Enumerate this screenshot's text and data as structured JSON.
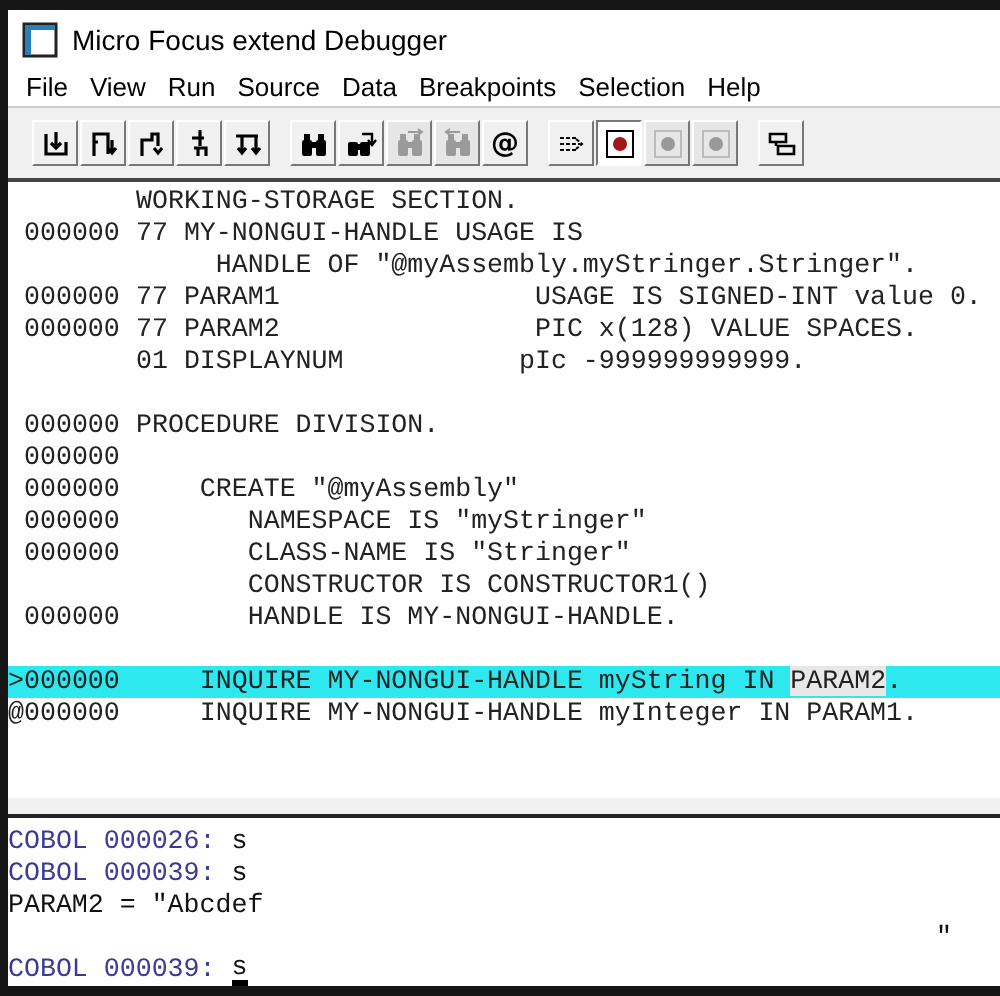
{
  "window": {
    "title": "Micro Focus extend Debugger"
  },
  "menu": [
    "File",
    "View",
    "Run",
    "Source",
    "Data",
    "Breakpoints",
    "Selection",
    "Help"
  ],
  "toolbar": [
    [
      {
        "kind": "into",
        "disabled": false
      },
      {
        "kind": "over",
        "disabled": false
      },
      {
        "kind": "out",
        "disabled": false
      },
      {
        "kind": "up",
        "disabled": false
      },
      {
        "kind": "continue",
        "disabled": false
      }
    ],
    [
      {
        "kind": "find",
        "disabled": false
      },
      {
        "kind": "findnext",
        "disabled": false
      },
      {
        "kind": "forward",
        "disabled": true
      },
      {
        "kind": "back",
        "disabled": true
      },
      {
        "kind": "at",
        "label": "@",
        "disabled": false
      }
    ],
    [
      {
        "kind": "goto",
        "disabled": false
      },
      {
        "kind": "breakpoint",
        "disabled": false
      },
      {
        "kind": "breakpoint",
        "disabled": true
      },
      {
        "kind": "breakpoint",
        "disabled": true
      }
    ],
    [
      {
        "kind": "windows",
        "disabled": false
      }
    ]
  ],
  "source": [
    {
      "code": "WORKING-STORAGE SECTION.",
      "current": false
    },
    {
      "number": "000000",
      "code": "77 MY-NONGUI-HANDLE USAGE IS",
      "current": false
    },
    {
      "code": "     HANDLE OF \"@myAssembly.myStringer.Stringer\".",
      "current": false
    },
    {
      "number": "000000",
      "code": "77 PARAM1                USAGE IS SIGNED-INT value 0.",
      "current": false
    },
    {
      "number": "000000",
      "code": "77 PARAM2                PIC x(128) VALUE SPACES.",
      "current": false
    },
    {
      "code": "01 DISPLAYNUM           pIc -999999999999.",
      "current": false
    },
    {
      "current": false
    },
    {
      "number": "000000",
      "code": "PROCEDURE DIVISION.",
      "current": false
    },
    {
      "number": "000000",
      "current": false
    },
    {
      "number": "000000",
      "code": "    CREATE \"@myAssembly\"",
      "current": false
    },
    {
      "number": "000000",
      "code": "       NAMESPACE IS \"myStringer\"",
      "current": false
    },
    {
      "number": "000000",
      "code": "       CLASS-NAME IS \"Stringer\"",
      "current": false
    },
    {
      "code": "       CONSTRUCTOR IS CONSTRUCTOR1()",
      "current": false
    },
    {
      "number": "000000",
      "code": "       HANDLE IS MY-NONGUI-HANDLE.",
      "current": false
    },
    {
      "current": false
    },
    {
      "marker": ">",
      "number": "000000",
      "code": "    INQUIRE MY-NONGUI-HANDLE myString IN ",
      "selection": "PARAM2",
      "code_end": ".",
      "current": true
    },
    {
      "marker": "@",
      "number": "000000",
      "code": "    INQUIRE MY-NONGUI-HANDLE myInteger IN PARAM1.",
      "current": false
    }
  ],
  "console": [
    {
      "kind": "command",
      "prompt": "COBOL 000026:",
      "text": "s"
    },
    {
      "kind": "command",
      "prompt": "COBOL 000039:",
      "text": "s"
    },
    {
      "kind": "output",
      "text": "PARAM2 = \"Abcdef"
    },
    {
      "kind": "continuation",
      "text": "\""
    },
    {
      "kind": "command",
      "prompt": "COBOL 000039:",
      "text": "s",
      "cursor": true
    }
  ]
}
